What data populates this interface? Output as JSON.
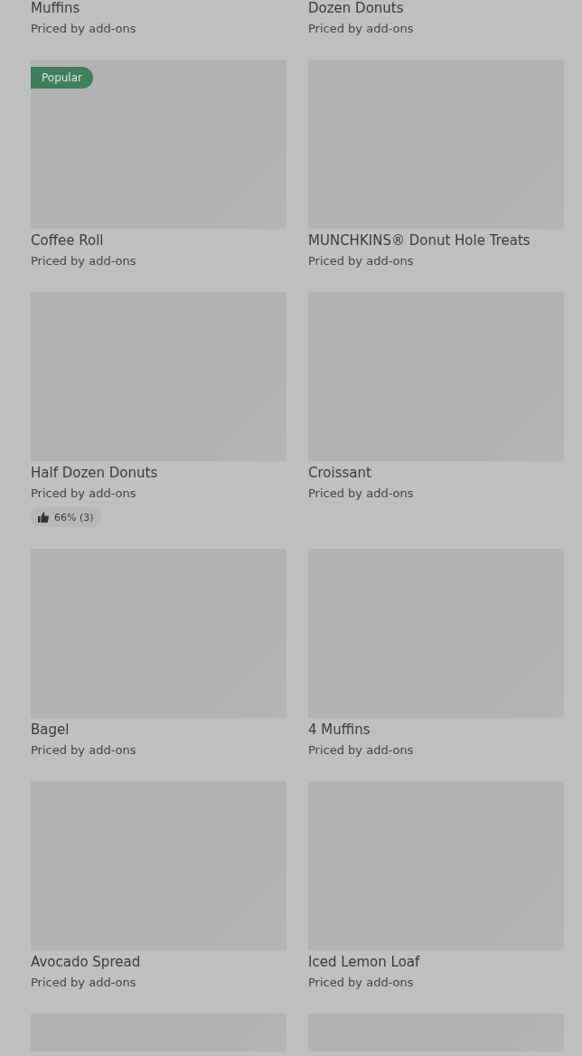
{
  "items": [
    {
      "kind": "cut-top",
      "name": "Muffins",
      "price": "Priced by add-ons"
    },
    {
      "kind": "cut-top",
      "name": "Dozen Donuts",
      "price": "Priced by add-ons"
    },
    {
      "kind": "full",
      "name": "Coffee Roll",
      "price": "Priced by add-ons",
      "badge": "Popular"
    },
    {
      "kind": "full",
      "name": "MUNCHKINS® Donut Hole Treats",
      "price": "Priced by add-ons"
    },
    {
      "kind": "full",
      "name": "Half Dozen Donuts",
      "price": "Priced by add-ons",
      "rating": "66% (3)"
    },
    {
      "kind": "full",
      "name": "Croissant",
      "price": "Priced by add-ons"
    },
    {
      "kind": "full",
      "name": "Bagel",
      "price": "Priced by add-ons"
    },
    {
      "kind": "full",
      "name": "4 Muffins",
      "price": "Priced by add-ons"
    },
    {
      "kind": "full",
      "name": "Avocado Spread",
      "price": "Priced by add-ons"
    },
    {
      "kind": "full",
      "name": "Iced Lemon Loaf",
      "price": "Priced by add-ons"
    },
    {
      "kind": "cut-bottom"
    },
    {
      "kind": "cut-bottom"
    }
  ]
}
